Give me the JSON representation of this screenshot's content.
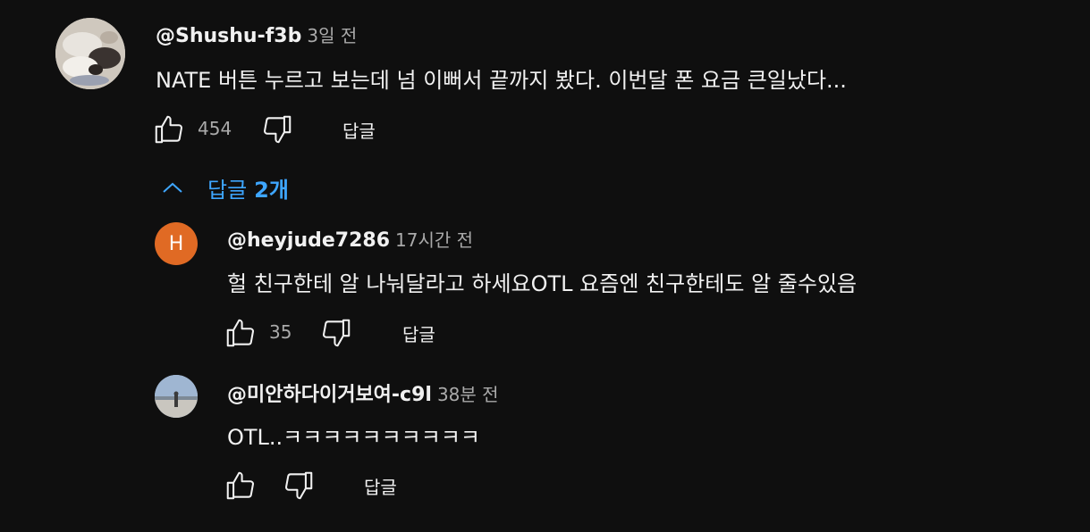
{
  "colors": {
    "background": "#0f0f0f",
    "text": "#f1f1f1",
    "muted": "#aaaaaa",
    "link": "#3ea6ff",
    "avatar_h_bg": "#e06a24"
  },
  "comment": {
    "handle": "@Shushu-f3b",
    "time": "3일 전",
    "text": "NATE 버튼 누르고 보는데 넘 이뻐서 끝까지 봤다. 이번달 폰 요금 큰일났다...",
    "likes": "454",
    "reply_label": "답글",
    "avatar_icon": "cat-photo-avatar"
  },
  "replies_toggle": {
    "label": "답글",
    "count": "2개",
    "icon": "chevron-up-icon"
  },
  "replies": [
    {
      "avatar_letter": "H",
      "handle": "@heyjude7286",
      "time": "17시간 전",
      "text": "헐 친구한테 알 나눠달라고 하세요OTL 요즘엔 친구한테도 알 줄수있음",
      "likes": "35",
      "reply_label": "답글"
    },
    {
      "avatar_icon": "sky-photo-avatar",
      "handle": "@미안하다이거보여-c9l",
      "time": "38분 전",
      "text": "OTL..ㅋㅋㅋㅋㅋㅋㅋㅋㅋㅋ",
      "likes": "",
      "reply_label": "답글"
    }
  ]
}
